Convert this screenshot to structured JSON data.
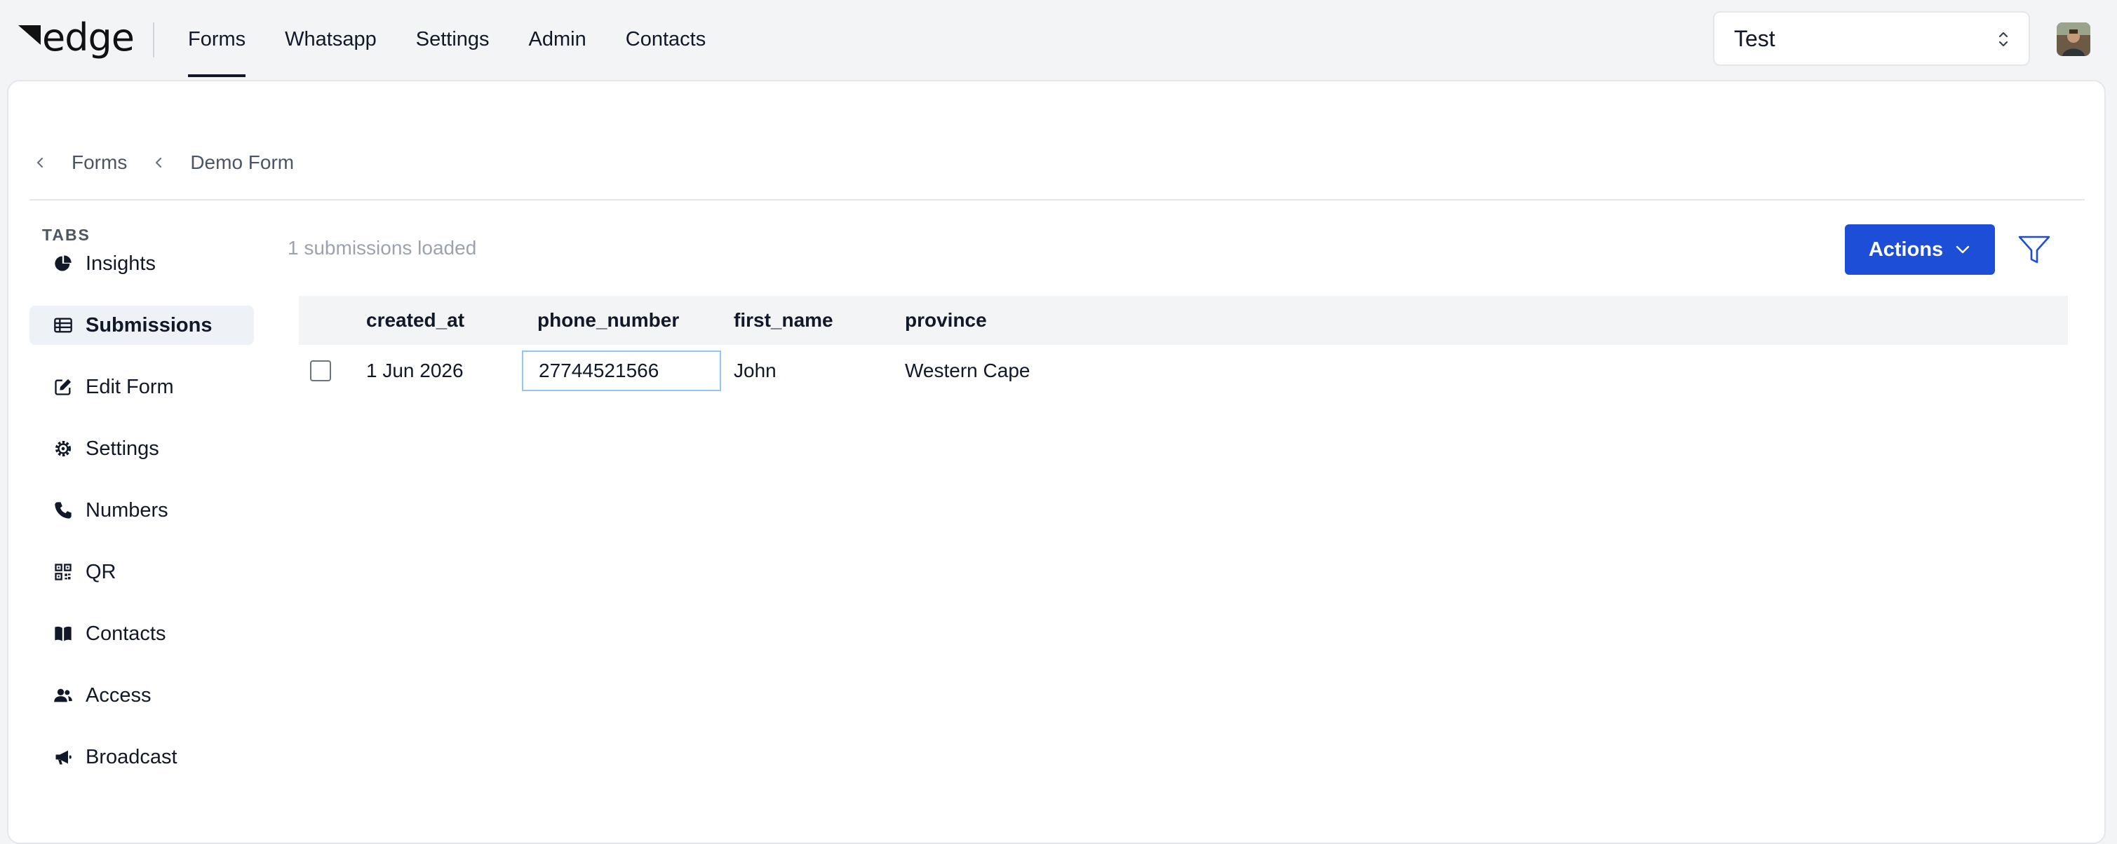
{
  "app": {
    "logo_text": "edge"
  },
  "nav": {
    "items": [
      {
        "label": "Forms",
        "active": true
      },
      {
        "label": "Whatsapp"
      },
      {
        "label": "Settings"
      },
      {
        "label": "Admin"
      },
      {
        "label": "Contacts"
      }
    ]
  },
  "org_select": {
    "value": "Test"
  },
  "breadcrumb": {
    "items": [
      "Forms",
      "Demo Form"
    ]
  },
  "sidebar": {
    "heading": "TABS",
    "items": [
      {
        "label": "Insights",
        "icon": "pie-chart-icon"
      },
      {
        "label": "Submissions",
        "icon": "table-icon",
        "active": true
      },
      {
        "label": "Edit Form",
        "icon": "edit-icon"
      },
      {
        "label": "Settings",
        "icon": "gear-icon"
      },
      {
        "label": "Numbers",
        "icon": "phone-icon"
      },
      {
        "label": "QR",
        "icon": "qr-code-icon"
      },
      {
        "label": "Contacts",
        "icon": "book-icon"
      },
      {
        "label": "Access",
        "icon": "users-icon"
      },
      {
        "label": "Broadcast",
        "icon": "megaphone-icon"
      }
    ]
  },
  "content": {
    "status_text": "1 submissions loaded",
    "actions_label": "Actions",
    "filter_icon": "filter-icon",
    "columns": [
      "created_at",
      "phone_number",
      "first_name",
      "province"
    ],
    "rows": [
      {
        "created_at": "1 Jun 2026",
        "phone_number": "27744521566",
        "first_name": "John",
        "province": "Western Cape"
      }
    ]
  },
  "colors": {
    "accent": "#1d4ed8",
    "background": "#f3f4f6",
    "panel": "#ffffff"
  }
}
